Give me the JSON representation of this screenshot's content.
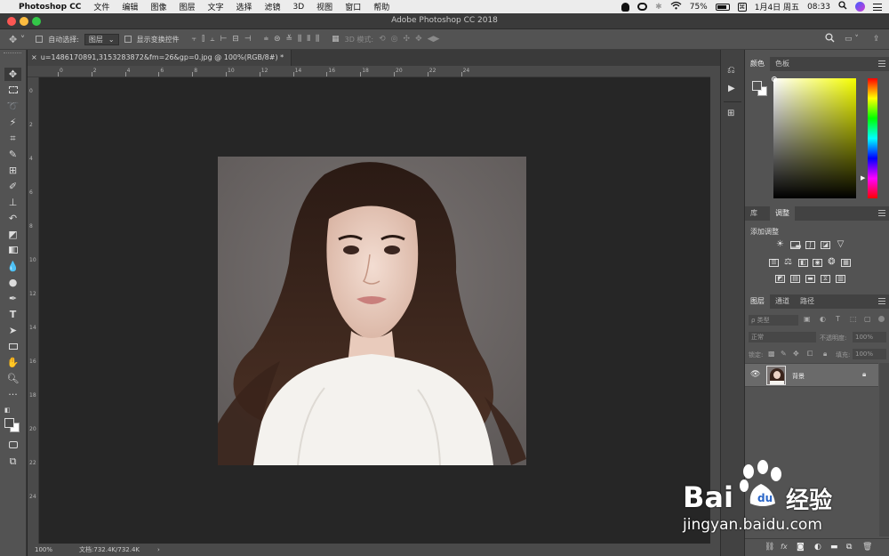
{
  "menubar": {
    "apple": "",
    "app_name": "Photoshop CC",
    "items": [
      "文件",
      "编辑",
      "图像",
      "图层",
      "文字",
      "选择",
      "滤镜",
      "3D",
      "视图",
      "窗口",
      "帮助"
    ],
    "battery": "75%",
    "date": "1月4日 周五",
    "time": "08:33"
  },
  "window": {
    "title": "Adobe Photoshop CC 2018"
  },
  "options": {
    "auto_select_label": "自动选择:",
    "auto_select_value": "图层",
    "show_transform_label": "显示变换控件",
    "mode_3d_label": "3D 模式:"
  },
  "document": {
    "tab_title": "u=1486170891,3153283872&fm=26&gp=0.jpg @ 100%(RGB/8#) *",
    "close_glyph": "×"
  },
  "ruler": {
    "h_ticks": [
      "0",
      "2",
      "4",
      "6",
      "8",
      "10",
      "12",
      "14",
      "16",
      "18",
      "20",
      "22",
      "24"
    ],
    "v_ticks": [
      "0",
      "2",
      "4",
      "6",
      "8",
      "10",
      "12",
      "14",
      "16",
      "18",
      "20",
      "22",
      "24"
    ]
  },
  "status": {
    "zoom": "100%",
    "doc": "文档:732.4K/732.4K",
    "arrow": "›"
  },
  "panels": {
    "color_tabs": [
      "颜色",
      "色板"
    ],
    "adjust_tabs": [
      "库",
      "调整"
    ],
    "adjust_title": "添加调整",
    "layers_tabs": [
      "图层",
      "通道",
      "路径"
    ],
    "filter_label": "ρ 类型",
    "blend_mode": "正常",
    "opacity_label": "不透明度:",
    "opacity_value": "100%",
    "lock_label": "锁定:",
    "fill_label": "填充:",
    "fill_value": "100%",
    "layer_name": "背景"
  },
  "watermark": {
    "brand": "Bai",
    "brand2": "经验",
    "url": "jingyan.baidu.com"
  },
  "colors": {
    "accent_red": "#fc5753",
    "accent_yellow": "#fdbc40",
    "accent_green": "#33c748"
  }
}
